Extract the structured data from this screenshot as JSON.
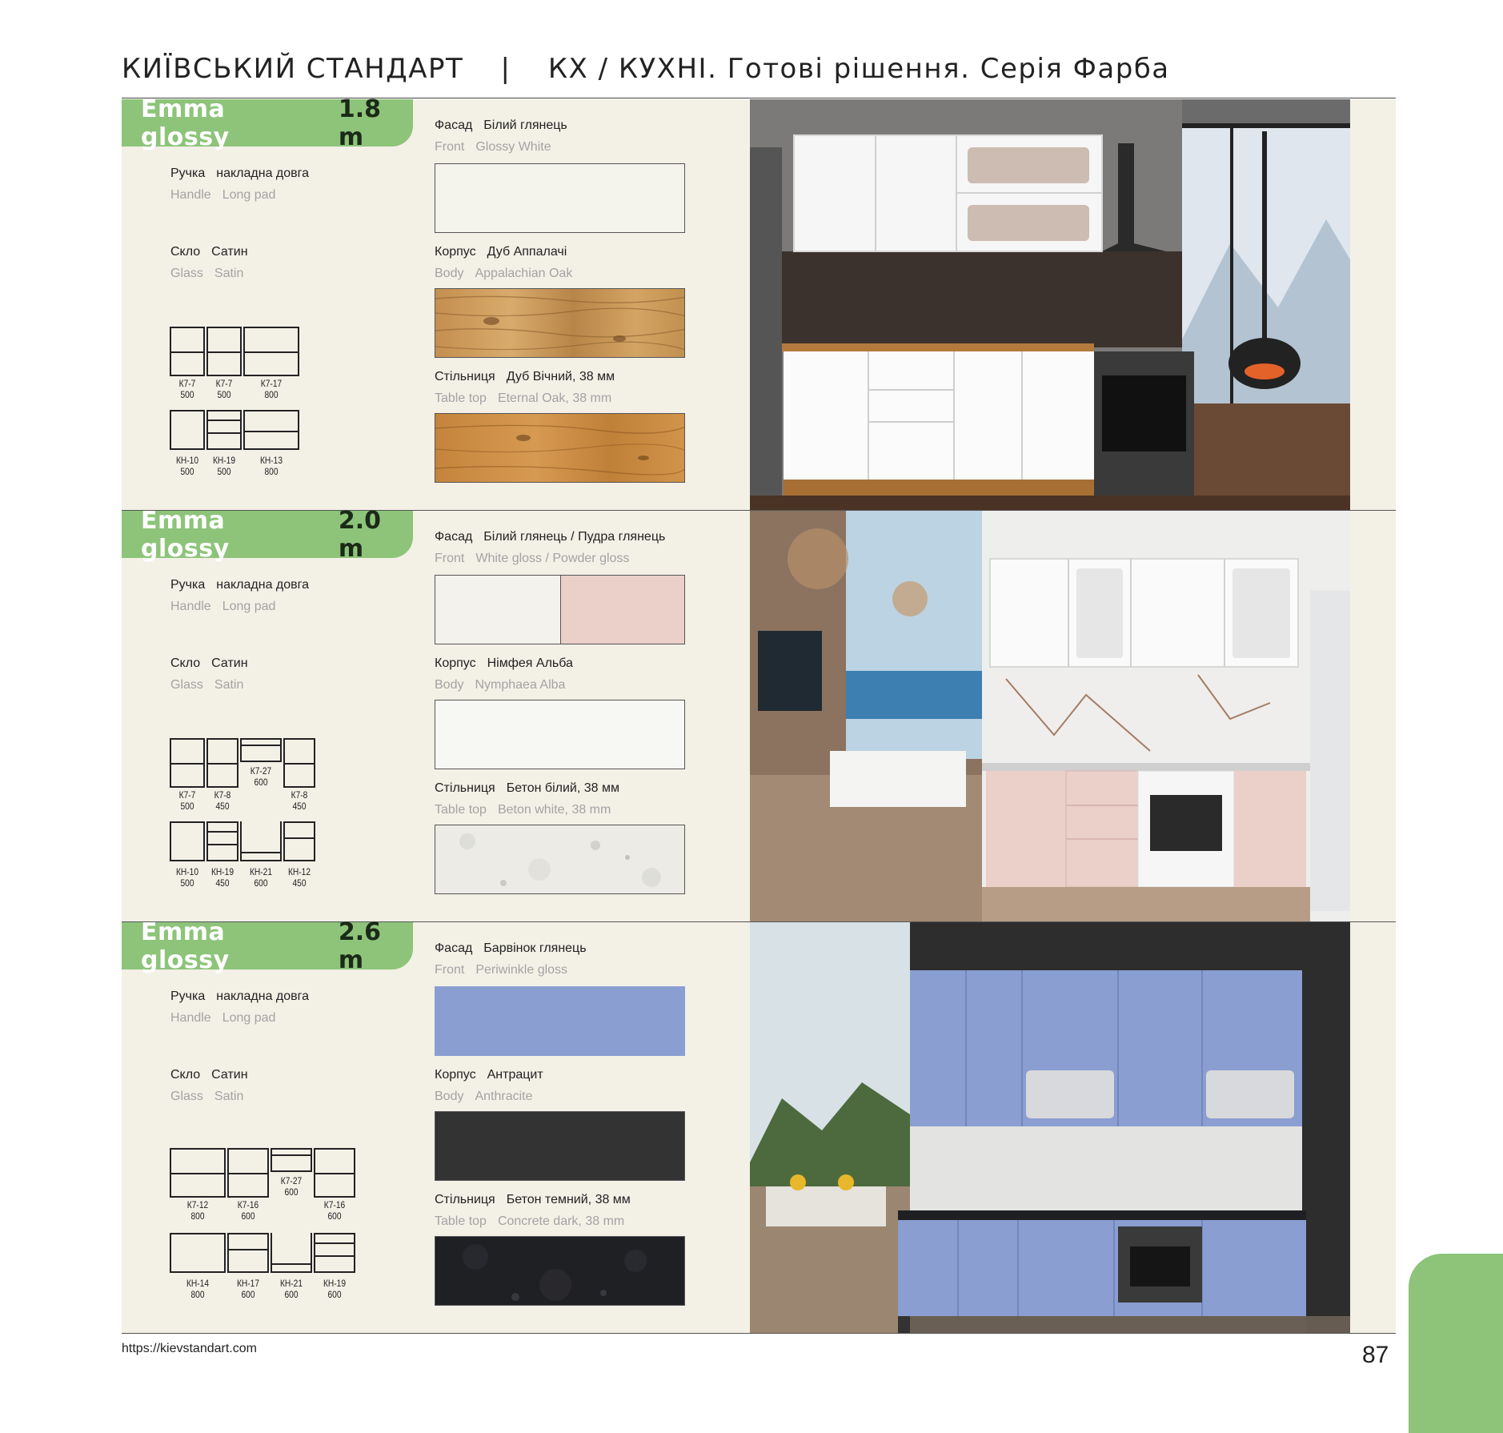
{
  "header": {
    "brand": "КИЇВСЬКИЙ СТАНДАРТ",
    "separator": "|",
    "title": "КХ / КУХНІ. Готові рішення.  Серія Фарба"
  },
  "sections": [
    {
      "name": "Emma glossy",
      "size": "1.8 m",
      "handle": {
        "ua_key": "Ручка",
        "ua_val": "накладна довга",
        "en_key": "Handle",
        "en_val": "Long pad"
      },
      "glass": {
        "ua_key": "Скло",
        "ua_val": "Сатин",
        "en_key": "Glass",
        "en_val": "Satin"
      },
      "front": {
        "ua_key": "Фасад",
        "ua_val": "Білий глянець",
        "en_key": "Front",
        "en_val": "Glossy White",
        "colors": [
          "#f4f3ec"
        ]
      },
      "body": {
        "ua_key": "Корпус",
        "ua_val": "Дуб Аппалачі",
        "en_key": "Body",
        "en_val": "Appalachian Oak",
        "colors": [
          "#c79a5a"
        ]
      },
      "top": {
        "ua_key": "Стільниця",
        "ua_val": "Дуб Вічний, 38 мм",
        "en_key": "Table top",
        "en_val": "Eternal Oak, 38 mm",
        "colors": [
          "#c98d45"
        ]
      },
      "modules_top": [
        {
          "code": "К7-7",
          "width": "500"
        },
        {
          "code": "К7-7",
          "width": "500"
        },
        {
          "code": "К7-17",
          "width": "800"
        }
      ],
      "modules_bottom": [
        {
          "code": "КН-10",
          "width": "500"
        },
        {
          "code": "КН-19",
          "width": "500"
        },
        {
          "code": "КН-13",
          "width": "800"
        }
      ]
    },
    {
      "name": "Emma glossy",
      "size": "2.0 m",
      "handle": {
        "ua_key": "Ручка",
        "ua_val": "накладна довга",
        "en_key": "Handle",
        "en_val": "Long pad"
      },
      "glass": {
        "ua_key": "Скло",
        "ua_val": "Сатин",
        "en_key": "Glass",
        "en_val": "Satin"
      },
      "front": {
        "ua_key": "Фасад",
        "ua_val": "Білий глянець / Пудра глянець",
        "en_key": "Front",
        "en_val": "White gloss / Powder gloss",
        "colors": [
          "#f3f2ec",
          "#ebcfc9"
        ]
      },
      "body": {
        "ua_key": "Корпус",
        "ua_val": "Німфея Альба",
        "en_key": "Body",
        "en_val": "Nymphaea Alba",
        "colors": [
          "#f7f7f4"
        ]
      },
      "top": {
        "ua_key": "Стільниця",
        "ua_val": "Бетон білий, 38 мм",
        "en_key": "Table top",
        "en_val": "Beton white, 38 mm",
        "colors": [
          "#ecebe6"
        ]
      },
      "modules_top": [
        {
          "code": "К7-7",
          "width": "500"
        },
        {
          "code": "К7-8",
          "width": "450"
        },
        {
          "code": "К7-27",
          "width": "600"
        },
        {
          "code": "К7-8",
          "width": "450"
        }
      ],
      "modules_bottom": [
        {
          "code": "КН-10",
          "width": "500"
        },
        {
          "code": "КН-19",
          "width": "450"
        },
        {
          "code": "КН-21",
          "width": "600"
        },
        {
          "code": "КН-12",
          "width": "450"
        }
      ]
    },
    {
      "name": "Emma glossy",
      "size": "2.6 m",
      "handle": {
        "ua_key": "Ручка",
        "ua_val": "накладна довга",
        "en_key": "Handle",
        "en_val": "Long pad"
      },
      "glass": {
        "ua_key": "Скло",
        "ua_val": "Сатин",
        "en_key": "Glass",
        "en_val": "Satin"
      },
      "front": {
        "ua_key": "Фасад",
        "ua_val": "Барвінок глянець",
        "en_key": "Front",
        "en_val": "Periwinkle gloss",
        "colors": [
          "#8a9ed1"
        ]
      },
      "body": {
        "ua_key": "Корпус",
        "ua_val": "Антрацит",
        "en_key": "Body",
        "en_val": "Anthracite",
        "colors": [
          "#333333"
        ]
      },
      "top": {
        "ua_key": "Стільниця",
        "ua_val": "Бетон темний, 38 мм",
        "en_key": "Table top",
        "en_val": "Concrete dark, 38 mm",
        "colors": [
          "#1e1f22"
        ]
      },
      "modules_top": [
        {
          "code": "К7-12",
          "width": "800"
        },
        {
          "code": "К7-16",
          "width": "600"
        },
        {
          "code": "К7-27",
          "width": "600"
        },
        {
          "code": "К7-16",
          "width": "600"
        }
      ],
      "modules_bottom": [
        {
          "code": "КН-14",
          "width": "800"
        },
        {
          "code": "КН-17",
          "width": "600"
        },
        {
          "code": "КН-21",
          "width": "600"
        },
        {
          "code": "КН-19",
          "width": "600"
        }
      ]
    }
  ],
  "footer": {
    "url": "https://kievstandart.com",
    "page_number": "87"
  }
}
